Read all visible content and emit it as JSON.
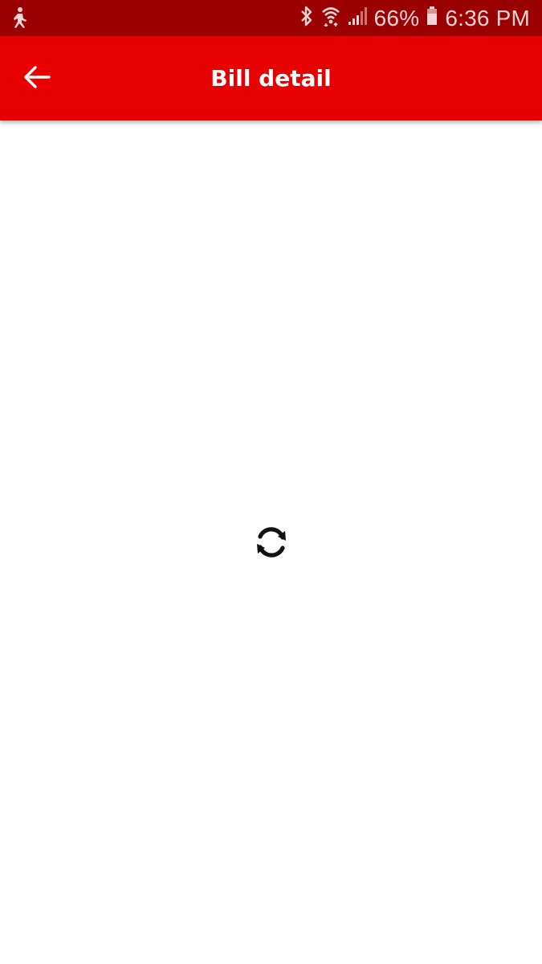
{
  "status_bar": {
    "left_icon": "accessibility-person-icon",
    "icons": [
      "bluetooth-icon",
      "wifi-icon",
      "cellular-signal-icon",
      "battery-icon"
    ],
    "battery_percent": "66%",
    "time": "6:36 PM"
  },
  "app_bar": {
    "title": "Bill detail",
    "back_icon": "arrow-back-icon",
    "background_color": "#e60000"
  },
  "content": {
    "loading_icon": "refresh-icon",
    "background_color": "#ffffff"
  },
  "colors": {
    "status_bar": "#9b0000",
    "app_bar": "#e60000",
    "app_bar_text": "#ffffff"
  }
}
